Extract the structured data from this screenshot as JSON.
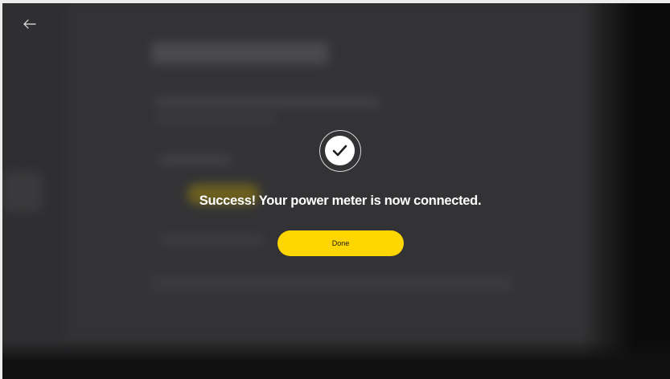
{
  "header": {
    "back_icon": "arrow-left-icon"
  },
  "dialog": {
    "status_icon": "checkmark-circle-icon",
    "message": "Success! Your power meter is now connected.",
    "done_label": "Done"
  },
  "colors": {
    "accent": "#ffd600",
    "background": "#2f2f31",
    "text": "#ffffff"
  }
}
